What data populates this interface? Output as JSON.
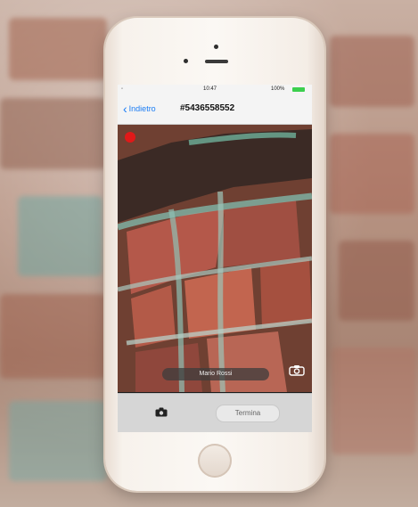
{
  "statusbar": {
    "time": "10:47",
    "battery": "100%"
  },
  "navbar": {
    "back_label": "Indietro",
    "title": "#5436558552"
  },
  "video": {
    "caption": "Mario Rossi",
    "recording": true
  },
  "toolbar": {
    "end_label": "Termina"
  },
  "icons": {
    "back": "chevron-left-icon",
    "camera_switch": "camera-icon",
    "snapshot": "camera-icon"
  },
  "colors": {
    "accent": "#1a7cf5",
    "record": "#e01919"
  }
}
